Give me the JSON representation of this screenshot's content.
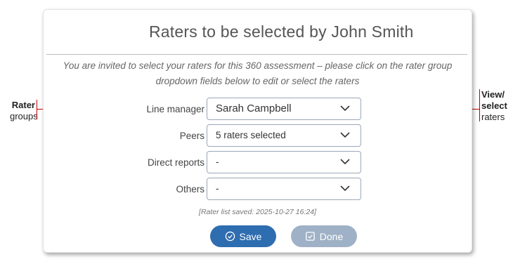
{
  "dialog": {
    "title": "Raters to be selected by  John Smith",
    "intro": "You are invited to select your raters for this 360 assessment – please click on the rater group dropdown fields below to edit or select the raters",
    "rows": [
      {
        "label": "Line manager",
        "value": "Sarah Campbell"
      },
      {
        "label": "Peers",
        "value": "5 raters selected"
      },
      {
        "label": "Direct reports",
        "value": "-"
      },
      {
        "label": "Others",
        "value": "-"
      }
    ],
    "saved_note": "[Rater list saved: 2025-10-27 16:24]",
    "save_label": "Save",
    "done_label": "Done"
  },
  "annotations": {
    "left_bold": "Rater",
    "left_normal": "groups",
    "right_bold_1": "View/",
    "right_bold_2": "select",
    "right_normal": "raters"
  },
  "colors": {
    "save_button": "#2e6db0",
    "done_button": "#9fb1c6",
    "annotation_line": "#c00000"
  }
}
